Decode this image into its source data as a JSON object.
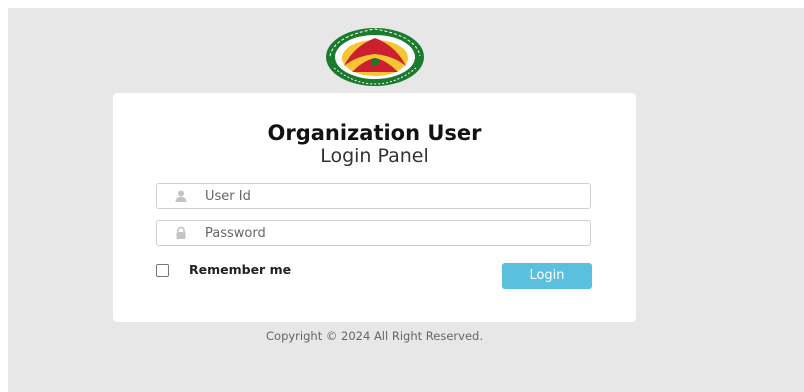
{
  "logo": {
    "ring_text_top": "রেহাবের বাংলাদেশ",
    "ring_text_bottom": "BAGF BANGLADESH",
    "colors": {
      "ring": "#1a7a2e",
      "inner": "#f7c531",
      "arch": "#cc1f2f"
    }
  },
  "login": {
    "title": "Organization User",
    "subtitle": "Login Panel",
    "user_id": {
      "value": "",
      "placeholder": "User Id",
      "icon": "user-icon"
    },
    "password": {
      "value": "",
      "placeholder": "Password",
      "icon": "lock-icon"
    },
    "remember_label": "Remember me",
    "remember_checked": false,
    "login_label": "Login",
    "accent_color": "#5bc0de"
  },
  "footer": {
    "copyright": "Copyright © 2024 All Right Reserved."
  }
}
